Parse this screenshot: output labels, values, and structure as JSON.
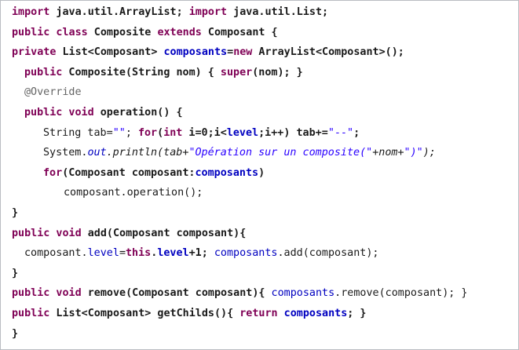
{
  "code": {
    "lines": [
      [
        "import",
        " java.util.ArrayList; ",
        "import",
        " java.util.List;"
      ],
      [
        "public class",
        " Composite ",
        "extends",
        " Composant {"
      ],
      [
        "private",
        " List<Composant> ",
        "composants",
        "=",
        "new",
        " ArrayList<Composant>();"
      ],
      [
        "public",
        " Composite(String nom) { ",
        "super",
        "(nom); }"
      ],
      [
        "@Override"
      ],
      [
        "public void",
        " operation() {"
      ],
      [
        "String tab=",
        "\"\"",
        "; ",
        "for",
        "(",
        "int",
        " i=0;i<",
        "level",
        ";i++) tab+=",
        "\"--\"",
        ";"
      ],
      [
        "System.",
        "out",
        ".println(tab+",
        "\"Opération sur un composite(\"",
        "+nom+",
        "\")\"",
        ");"
      ],
      [
        "for",
        "(Composant composant:",
        "composants",
        ")"
      ],
      [
        "composant.operation();"
      ],
      [
        "}"
      ],
      [
        "public void",
        " add(Composant composant){"
      ],
      [
        "composant.",
        "level",
        "=",
        "this",
        ".",
        "level",
        "+1; ",
        "composants",
        ".add(composant);"
      ],
      [
        "}"
      ],
      [
        "public void",
        " remove(Composant composant){ ",
        "composants",
        ".remove(composant); }"
      ],
      [
        "public",
        " List<Composant> getChilds(){ ",
        "return",
        " ",
        "composants",
        "; }"
      ],
      [
        "}"
      ]
    ]
  }
}
